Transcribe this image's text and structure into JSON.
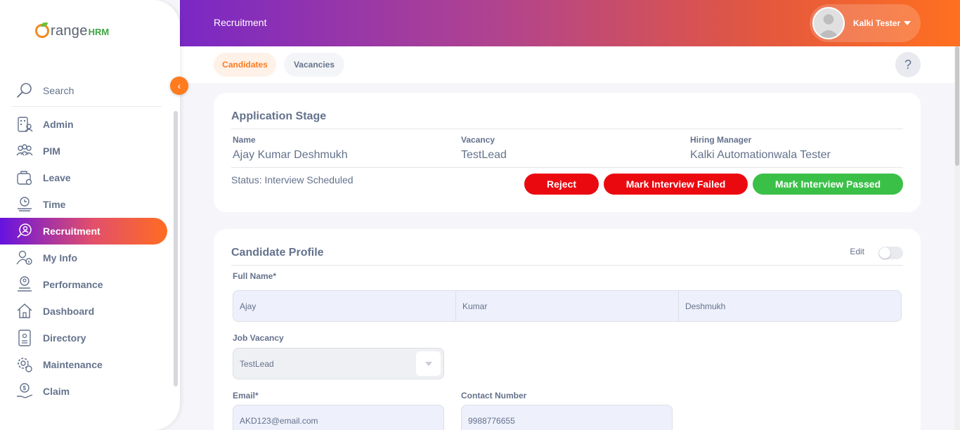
{
  "sidebar": {
    "brand": {
      "word": "range",
      "suffix": "HRM"
    },
    "search_label": "Search",
    "collapse_icon": "chevron-left-icon",
    "items": [
      {
        "label": "Admin",
        "icon": "admin-icon"
      },
      {
        "label": "PIM",
        "icon": "pim-icon"
      },
      {
        "label": "Leave",
        "icon": "leave-icon"
      },
      {
        "label": "Time",
        "icon": "time-icon"
      },
      {
        "label": "Recruitment",
        "icon": "recruitment-icon",
        "active": true
      },
      {
        "label": "My Info",
        "icon": "my-info-icon"
      },
      {
        "label": "Performance",
        "icon": "performance-icon"
      },
      {
        "label": "Dashboard",
        "icon": "dashboard-icon"
      },
      {
        "label": "Directory",
        "icon": "directory-icon"
      },
      {
        "label": "Maintenance",
        "icon": "maintenance-icon"
      },
      {
        "label": "Claim",
        "icon": "claim-icon"
      }
    ]
  },
  "header": {
    "title": "Recruitment",
    "user_name": "Kalki Tester"
  },
  "tabs": {
    "candidates": "Candidates",
    "vacancies": "Vacancies",
    "help": "?"
  },
  "application_stage": {
    "title": "Application Stage",
    "name_label": "Name",
    "name_value": "Ajay Kumar Deshmukh",
    "vacancy_label": "Vacancy",
    "vacancy_value": "TestLead",
    "manager_label": "Hiring Manager",
    "manager_value": "Kalki Automationwala Tester",
    "status": "Status: Interview Scheduled",
    "reject_label": "Reject",
    "fail_label": "Mark Interview Failed",
    "pass_label": "Mark Interview Passed"
  },
  "candidate_profile": {
    "title": "Candidate Profile",
    "edit_label": "Edit",
    "full_name_label": "Full Name*",
    "first_name": "Ajay",
    "middle_name": "Kumar",
    "last_name": "Deshmukh",
    "job_vacancy_label": "Job Vacancy",
    "job_vacancy_value": "TestLead",
    "email_label": "Email*",
    "email_value": "AKD123@email.com",
    "contact_label": "Contact Number",
    "contact_value": "9988776655"
  },
  "colors": {
    "accent": "#ff7b1d",
    "reject": "#eb0910",
    "pass": "#3ac047"
  }
}
